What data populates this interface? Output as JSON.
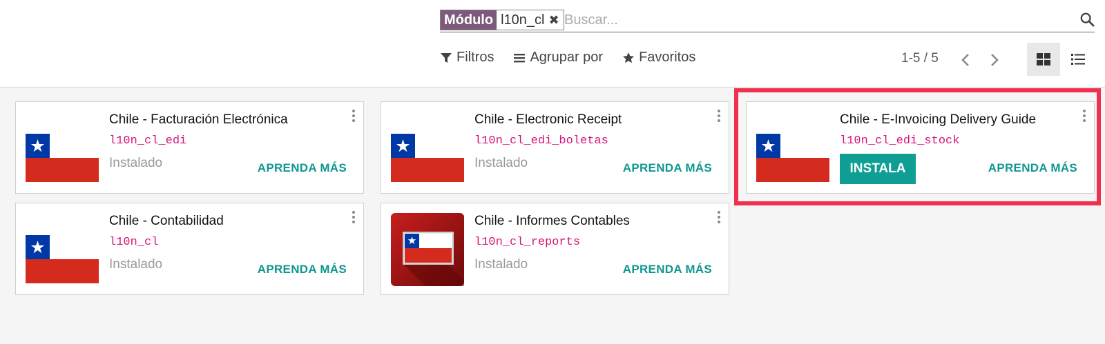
{
  "search": {
    "facet_label": "Módulo",
    "facet_value": "l10n_cl",
    "placeholder": "Buscar..."
  },
  "filters": {
    "filters_label": "Filtros",
    "group_label": "Agrupar por",
    "favorites_label": "Favoritos"
  },
  "pager": {
    "value": "1-5 / 5"
  },
  "colors": {
    "accent": "#0e9e94",
    "facet": "#7c5a7a",
    "tech_name": "#d6157b",
    "highlight": "#f0304f"
  },
  "cards": [
    {
      "title": "Chile - Facturación Electrónica",
      "tech": "l10n_cl_edi",
      "status": "Instalado",
      "learn": "APRENDA MÁS",
      "icon": "chile-flag-icon"
    },
    {
      "title": "Chile - Electronic Receipt",
      "tech": "l10n_cl_edi_boletas",
      "status": "Instalado",
      "learn": "APRENDA MÁS",
      "icon": "chile-flag-icon"
    },
    {
      "title": "Chile - E-Invoicing Delivery Guide",
      "tech": "l10n_cl_edi_stock",
      "install": "INSTALA",
      "learn": "APRENDA MÁS",
      "icon": "chile-flag-icon"
    },
    {
      "title": "Chile - Contabilidad",
      "tech": "l10n_cl",
      "status": "Instalado",
      "learn": "APRENDA MÁS",
      "icon": "chile-flag-icon"
    },
    {
      "title": "Chile - Informes Contables",
      "tech": "l10n_cl_reports",
      "status": "Instalado",
      "learn": "APRENDA MÁS",
      "icon": "chile-reports-icon"
    }
  ]
}
